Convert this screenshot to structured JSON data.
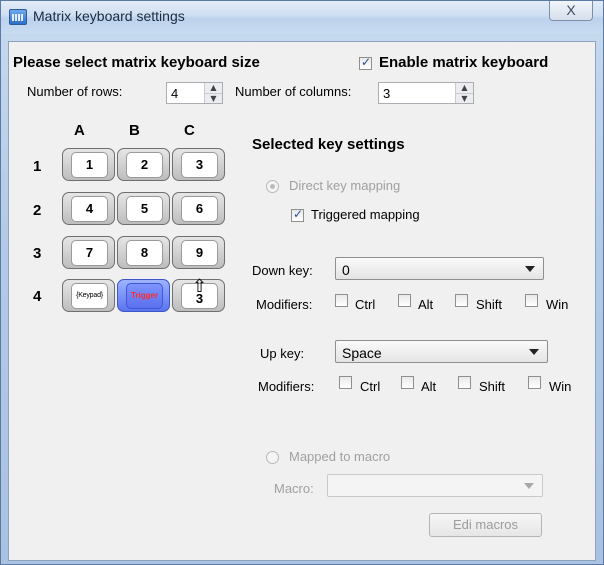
{
  "window": {
    "title": "Matrix keyboard settings",
    "close_label": "X"
  },
  "size": {
    "heading": "Please select matrix keyboard size",
    "enable_label": "Enable matrix keyboard",
    "enable_checked": true,
    "rows_label": "Number of rows:",
    "rows_value": "4",
    "cols_label": "Number of columns:",
    "cols_value": "3"
  },
  "matrix": {
    "columns": [
      "A",
      "B",
      "C"
    ],
    "rows": [
      "1",
      "2",
      "3",
      "4"
    ],
    "keys": [
      [
        "1",
        "2",
        "3"
      ],
      [
        "4",
        "5",
        "6"
      ],
      [
        "7",
        "8",
        "9"
      ],
      [
        "{Keypad}",
        "Trigger",
        "3"
      ]
    ]
  },
  "key_settings": {
    "heading": "Selected key settings",
    "direct_mapping_label": "Direct key mapping",
    "triggered_mapping_label": "Triggered mapping",
    "down_key_label": "Down key:",
    "down_key_value": "0",
    "up_key_label": "Up key:",
    "up_key_value": "Space",
    "modifiers_label": "Modifiers:",
    "mod_ctrl": "Ctrl",
    "mod_alt": "Alt",
    "mod_shift": "Shift",
    "mod_win": "Win",
    "macro_radio_label": "Mapped to macro",
    "macro_label": "Macro:",
    "macro_value": "",
    "edit_macros_label": "Edi macros"
  },
  "icons": {
    "app": "keyboard-icon",
    "cursor": "hand-pointer-cursor"
  }
}
